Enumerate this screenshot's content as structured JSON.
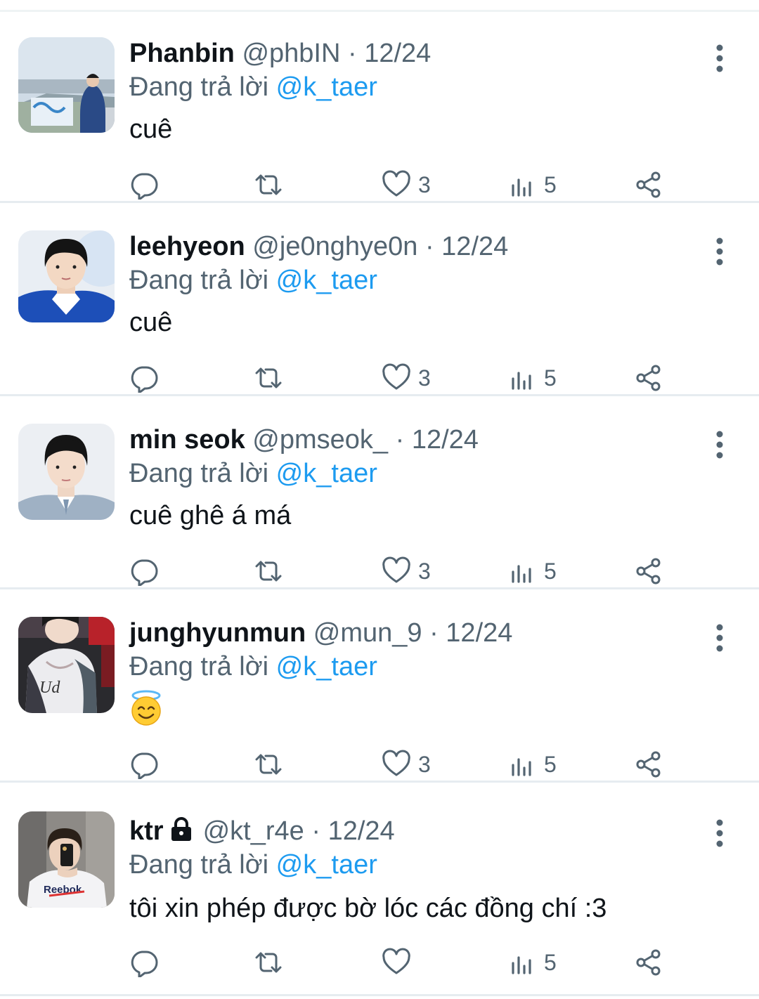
{
  "tweets": [
    {
      "display_name": "Phanbin",
      "handle": "@phbIN",
      "separator": "·",
      "date": "12/24",
      "reply_prefix": "Đang trả lời",
      "reply_to": "@k_taer",
      "text": "cuê",
      "likes": "3",
      "views": "5",
      "locked": false,
      "avatar": "avatar-photo-riverside",
      "has_emoji": false
    },
    {
      "display_name": "leehyeon",
      "handle": "@je0nghye0n",
      "separator": "·",
      "date": "12/24",
      "reply_prefix": "Đang trả lời",
      "reply_to": "@k_taer",
      "text": "cuê",
      "likes": "3",
      "views": "5",
      "locked": false,
      "avatar": "avatar-photo-portrait",
      "has_emoji": false
    },
    {
      "display_name": "min seok",
      "handle": "@pmseok_",
      "separator": "·",
      "date": "12/24",
      "reply_prefix": "Đang trả lời",
      "reply_to": "@k_taer",
      "text": "cuê ghê á má",
      "likes": "3",
      "views": "5",
      "locked": false,
      "avatar": "avatar-photo-suit",
      "has_emoji": false
    },
    {
      "display_name": "junghyunmun",
      "handle": "@mun_9",
      "separator": "·",
      "date": "12/24",
      "reply_prefix": "Đang trả lời",
      "reply_to": "@k_taer",
      "text": "",
      "emoji": "smiling-face-with-halo",
      "likes": "3",
      "views": "5",
      "locked": false,
      "avatar": "avatar-photo-hoodie",
      "has_emoji": true
    },
    {
      "display_name": "ktr",
      "handle": "@kt_r4e",
      "separator": "·",
      "date": "12/24",
      "reply_prefix": "Đang trả lời",
      "reply_to": "@k_taer",
      "text": "tôi xin phép được bờ lóc các đồng chí :3",
      "likes": "",
      "views": "5",
      "locked": true,
      "avatar": "avatar-photo-mirror-selfie",
      "has_emoji": false
    }
  ],
  "icons": {
    "reply": "reply-icon",
    "retweet": "retweet-icon",
    "like": "heart-icon",
    "views": "views-icon",
    "share": "share-icon",
    "more": "more-vertical-icon",
    "lock": "lock-icon"
  },
  "colors": {
    "text_primary": "#0f1419",
    "text_secondary": "#536471",
    "accent": "#1d9bf0",
    "divider": "#e6ecf0"
  }
}
